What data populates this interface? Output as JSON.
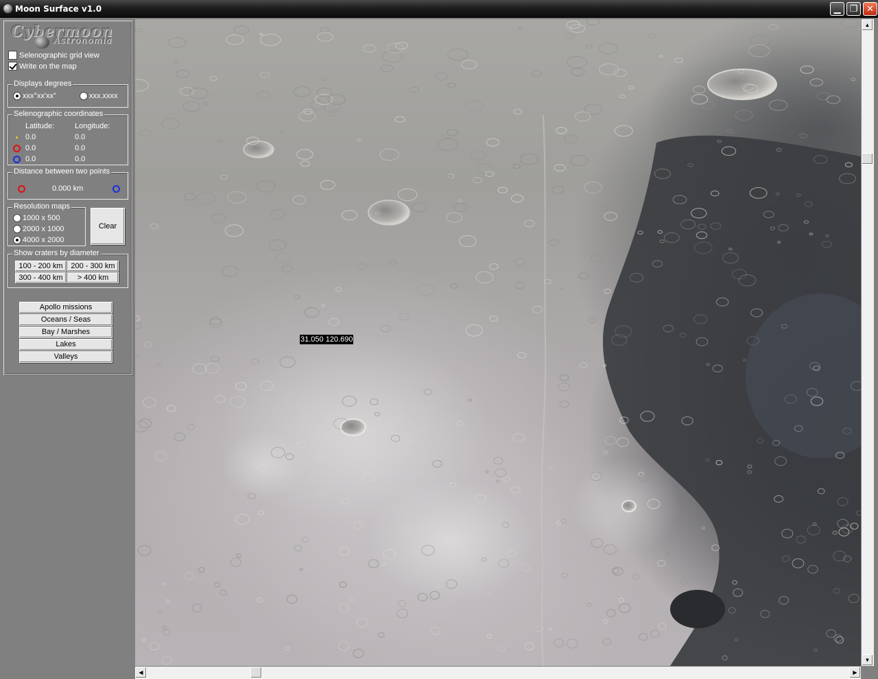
{
  "window": {
    "title": "Moon Surface v1.0",
    "min_symbol": "▁",
    "max_symbol": "❐",
    "close_symbol": "✕"
  },
  "logo": {
    "main": "Cybermoon",
    "sub": "Astronomia"
  },
  "options": {
    "grid_view_label": "Selenographic grid view",
    "grid_view_checked": false,
    "write_map_label": "Write on the map",
    "write_map_checked": true
  },
  "degrees": {
    "title": "Displays degrees",
    "option_dms": "xxx°xx'xx\"",
    "option_decimal": "xxx.xxxx",
    "selected": "dms"
  },
  "coordinates": {
    "title": "Selenographic coordinates",
    "lat_header": "Latitude:",
    "lon_header": "Longitude:",
    "rows": [
      {
        "marker": "yellow-dot",
        "lat": "0.0",
        "lon": "0.0"
      },
      {
        "marker": "red-circle",
        "lat": "0.0",
        "lon": "0.0"
      },
      {
        "marker": "blue-circle",
        "lat": "0.0",
        "lon": "0.0"
      }
    ]
  },
  "distance": {
    "title": "Distance between two points",
    "value": "0.000 km"
  },
  "resolution": {
    "title": "Resolution maps",
    "options": [
      "1000 x 500",
      "2000 x 1000",
      "4000 x 2000"
    ],
    "selected": "4000 x 2000",
    "clear_label": "Clear"
  },
  "craters": {
    "title": "Show craters by diameter",
    "buttons": [
      "100 - 200 km",
      "200 - 300 km",
      "300 - 400 km",
      "> 400 km"
    ]
  },
  "features": [
    "Apollo missions",
    "Oceans / Seas",
    "Bay / Marshes",
    "Lakes",
    "Valleys"
  ],
  "map": {
    "coordinate_label": "31.050 120.690",
    "mare_color": "#3a3c40",
    "highland_color": "#a8a6a4"
  },
  "scrollbars": {
    "vertical_position": 0.2,
    "horizontal_position": 0.15
  }
}
